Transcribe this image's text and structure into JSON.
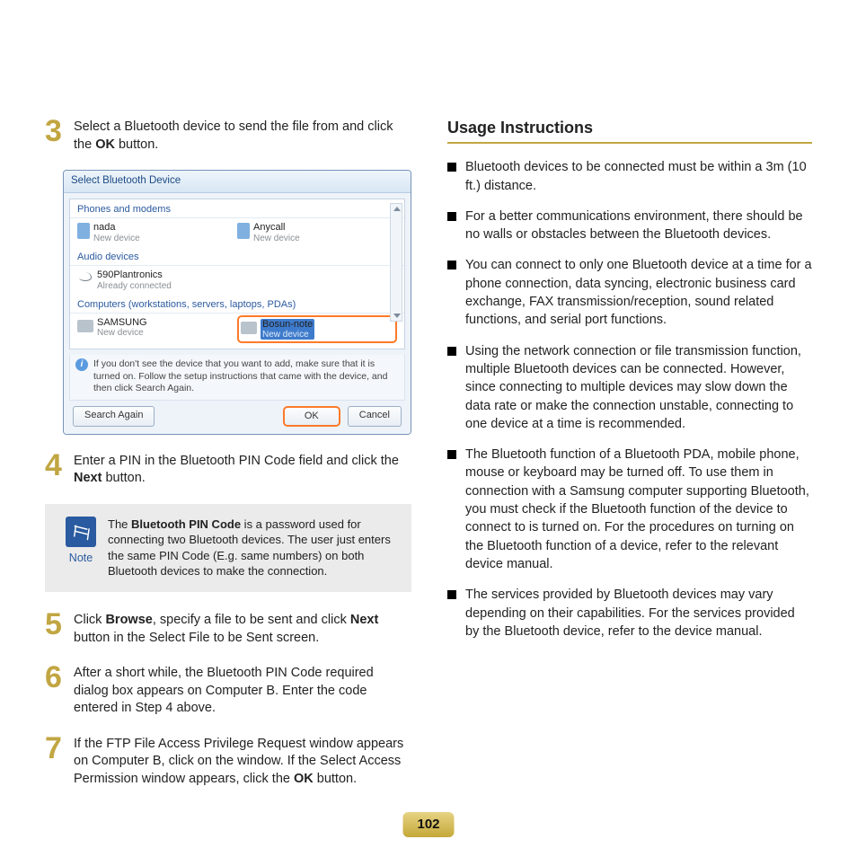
{
  "steps": {
    "s3": {
      "num": "3",
      "text_a": "Select a Bluetooth device to send the file from and click the ",
      "bold": "OK",
      "text_b": " button."
    },
    "s4": {
      "num": "4",
      "text_a": "Enter a PIN in the Bluetooth PIN Code field and click the ",
      "bold": "Next",
      "text_b": " button."
    },
    "s5": {
      "num": "5",
      "text_a": "Click ",
      "bold1": "Browse",
      "text_b": ", specify a file to be sent and click ",
      "bold2": "Next",
      "text_c": " button in the Select File to be Sent screen."
    },
    "s6": {
      "num": "6",
      "text": "After a short while, the Bluetooth PIN Code required dialog box appears on Computer B. Enter the code entered in Step 4 above."
    },
    "s7": {
      "num": "7",
      "text_a": "If the FTP File Access Privilege Request window appears on Computer B, click on the window. If the Select Access Permission window appears, click the ",
      "bold": "OK",
      "text_b": " button."
    }
  },
  "dialog": {
    "title": "Select Bluetooth Device",
    "cat_phones": "Phones and modems",
    "dev1_name": "nada",
    "dev1_sub": "New device",
    "dev2_name": "Anycall",
    "dev2_sub": "New device",
    "cat_audio": "Audio devices",
    "dev3_name": "590Plantronics",
    "dev3_sub": "Already connected",
    "cat_comp": "Computers (workstations, servers, laptops, PDAs)",
    "dev4_name": "SAMSUNG",
    "dev4_sub": "New device",
    "dev5_name": "Bosun-note",
    "dev5_sub": "New device",
    "info": "If you don't see the device that you want to add, make sure that it is turned on. Follow the setup instructions that came with the device, and then click Search Again.",
    "btn_search": "Search Again",
    "btn_ok": "OK",
    "btn_cancel": "Cancel"
  },
  "note": {
    "label": "Note",
    "text_a": "The ",
    "bold": "Bluetooth PIN Code",
    "text_b": " is a password used for connecting two Bluetooth devices. The user just enters the same PIN Code (E.g. same numbers) on both Bluetooth devices to make the connection."
  },
  "usage": {
    "title": "Usage Instructions",
    "items": [
      "Bluetooth devices to be connected must be within a 3m (10 ft.) distance.",
      "For a better communications environment, there should be no walls or obstacles between the Bluetooth devices.",
      "You can connect to only one Bluetooth device at a time for a phone connection, data syncing, electronic business card exchange, FAX transmission/reception, sound related functions, and serial port functions.",
      "Using the network connection or file transmission function, multiple Bluetooth devices can be connected. However, since connecting to multiple devices may slow down the data rate or make the connection unstable, connecting to one device at a time is recommended.",
      "The Bluetooth function of a Bluetooth PDA, mobile phone, mouse or keyboard may be turned off. To use them in connection with a Samsung computer supporting Bluetooth, you must check if the Bluetooth function of the device to connect to is turned on. For the procedures on turning on the Bluetooth function of a device, refer to the relevant device manual.",
      "The services provided by Bluetooth devices may vary depending on their capabilities. For the services provided by the Bluetooth device, refer to the device manual."
    ]
  },
  "page_number": "102"
}
